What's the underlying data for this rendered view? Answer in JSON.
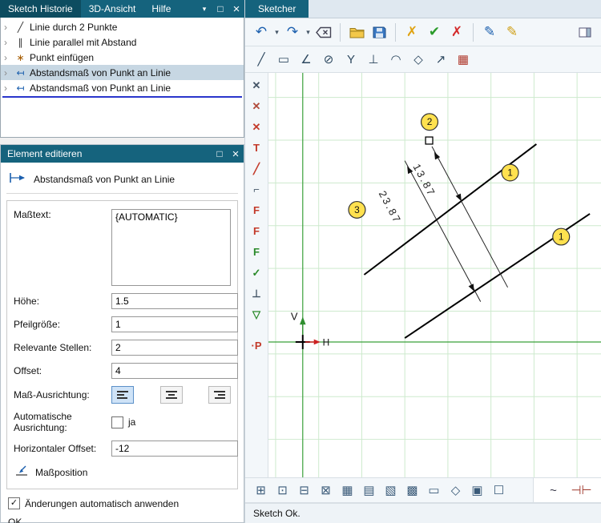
{
  "history_panel": {
    "chevron_glyph": "›",
    "tabs": [
      {
        "label": "Sketch Historie"
      },
      {
        "label": "3D-Ansicht"
      },
      {
        "label": "Hilfe"
      }
    ],
    "window_controls": {
      "menu_glyph": "▾",
      "maximize_glyph": "□",
      "close_glyph": "×"
    },
    "items": [
      {
        "label": "Linie durch 2 Punkte",
        "icon": "line-icon",
        "glyph": "╱",
        "color": "#333333",
        "selected": false
      },
      {
        "label": "Linie parallel mit Abstand",
        "icon": "parallel-lines-icon",
        "glyph": "∥",
        "color": "#333333",
        "selected": false
      },
      {
        "label": "Punkt einfügen",
        "icon": "point-icon",
        "glyph": "∗",
        "color": "#a65c00",
        "selected": false
      },
      {
        "label": "Abstandsmaß von Punkt an Linie",
        "icon": "dimension-icon",
        "glyph": "↤",
        "color": "#1b5fae",
        "selected": true
      },
      {
        "label": "Abstandsmaß von Punkt an Linie",
        "icon": "dimension-icon",
        "glyph": "↤",
        "color": "#1b5fae",
        "selected": false
      }
    ]
  },
  "edit_panel": {
    "title": "Element editieren",
    "window_controls": {
      "maximize_glyph": "□",
      "close_glyph": "×"
    },
    "header": "Abstandsmaß von Punkt an Linie",
    "fields": {
      "masstext": {
        "label": "Maßtext:",
        "value": "{AUTOMATIC}"
      },
      "hoehe": {
        "label": "Höhe:",
        "value": "1.5"
      },
      "pfeilgroesse": {
        "label": "Pfeilgröße:",
        "value": "1"
      },
      "relevante_stellen": {
        "label": "Relevante Stellen:",
        "value": "2"
      },
      "offset": {
        "label": "Offset:",
        "value": "4"
      },
      "mass_ausrichtung": {
        "label": "Maß-Ausrichtung:"
      },
      "automatische_ausrichtung": {
        "label": "Automatische Ausrichtung:",
        "option": "ja",
        "checked": false
      },
      "horizontaler_offset": {
        "label": "Horizontaler Offset:",
        "value": "-12"
      },
      "massposition": {
        "label": "Maßposition"
      }
    },
    "apply_checkbox": {
      "label": "Änderungen automatisch anwenden",
      "checked": true
    },
    "ok_label": "OK"
  },
  "sketcher": {
    "tab_label": "Sketcher",
    "status": "Sketch Ok.",
    "caret_glyph": "▾",
    "toolbar_main": [
      {
        "name": "undo-button",
        "glyph": "↶",
        "color": "#1b5fae",
        "caret": true
      },
      {
        "name": "redo-button",
        "glyph": "↷",
        "color": "#1b5fae",
        "caret": true
      },
      {
        "name": "backspace-button",
        "svg": "backspace"
      },
      {
        "sep": true
      },
      {
        "name": "open-file-button",
        "svg": "folder"
      },
      {
        "name": "save-button",
        "svg": "floppy"
      },
      {
        "sep": true
      },
      {
        "name": "delete-element-button",
        "glyph": "✗",
        "color": "#e0a312"
      },
      {
        "name": "confirm-button",
        "glyph": "✔",
        "color": "#2a9b2a"
      },
      {
        "name": "cancel-button",
        "glyph": "✗",
        "color": "#d42a2a"
      },
      {
        "sep": true
      },
      {
        "name": "edit-pencil-button",
        "glyph": "✎",
        "color": "#1b5fae"
      },
      {
        "name": "edit-pencil-alt-button",
        "glyph": "✎",
        "color": "#cf9f16"
      },
      {
        "spacer": true
      },
      {
        "name": "panel-toggle-button",
        "svg": "panel"
      }
    ],
    "toolbar_draw": [
      {
        "name": "polyline-tool-button",
        "glyph": "╱",
        "color": "#2e4960"
      },
      {
        "name": "rectangle-tool-button",
        "glyph": "▭",
        "color": "#2e4960"
      },
      {
        "name": "angle-tool-button",
        "glyph": "∠",
        "color": "#2e4960"
      },
      {
        "name": "circle-tool-button",
        "glyph": "⊘",
        "color": "#2e4960"
      },
      {
        "name": "branch-tool-button",
        "glyph": "Y",
        "color": "#2e4960"
      },
      {
        "name": "perpendicular-tool-button",
        "glyph": "⊥",
        "color": "#2e4960"
      },
      {
        "name": "arc-tool-button",
        "glyph": "◠",
        "color": "#2e4960"
      },
      {
        "name": "chamfer-tool-button",
        "glyph": "◇",
        "color": "#2e4960"
      },
      {
        "name": "point-line-tool-button",
        "glyph": "↗",
        "color": "#2e4960"
      },
      {
        "name": "grid-tool-button",
        "glyph": "▦",
        "color": "#b03a2e"
      }
    ],
    "toolbar_constraints": [
      {
        "name": "snap-x1-button",
        "glyph": "✕",
        "color": "#445566"
      },
      {
        "name": "snap-x2-button",
        "glyph": "✕",
        "color": "#b04a3a"
      },
      {
        "name": "snap-x3-button",
        "glyph": "✕",
        "color": "#c33a2a"
      },
      {
        "name": "tangent-constraint-button",
        "glyph": "T",
        "color": "#c33a2a"
      },
      {
        "name": "angle-constraint-button",
        "glyph": "╱",
        "color": "#c33a2a"
      },
      {
        "name": "corner-constraint-button",
        "glyph": "⌐",
        "color": "#445566"
      },
      {
        "name": "fix-point-constraint-button",
        "glyph": "F",
        "color": "#c33a2a"
      },
      {
        "name": "fix-angle-constraint-button",
        "glyph": "F",
        "color": "#c33a2a"
      },
      {
        "name": "fix-length-constraint-button",
        "glyph": "F",
        "color": "#2a8a2a"
      },
      {
        "name": "check-constraint-button",
        "glyph": "✓",
        "color": "#2a8a2a"
      },
      {
        "name": "perpendicular-constraint-button",
        "glyph": "⊥",
        "color": "#445566"
      },
      {
        "name": "triangle-constraint-button",
        "glyph": "▽",
        "color": "#2a8a2a"
      },
      {
        "gap": true
      },
      {
        "name": "point-display-button",
        "glyph": "·P",
        "color": "#c33a2a"
      }
    ],
    "toolbar_bottom": [
      {
        "name": "zoom-fit-button",
        "glyph": "⊞",
        "color": "#3a5a78"
      },
      {
        "name": "zoom-window-button",
        "glyph": "⊡",
        "color": "#3a5a78"
      },
      {
        "name": "zoom-minus-button",
        "glyph": "⊟",
        "color": "#3a5a78"
      },
      {
        "name": "zoom-select-button",
        "glyph": "⊠",
        "color": "#3a5a78"
      },
      {
        "name": "view-grid-button",
        "glyph": "▦",
        "color": "#3a5a78"
      },
      {
        "name": "view-rows-button",
        "glyph": "▤",
        "color": "#3a5a78"
      },
      {
        "name": "view-hatch-button",
        "glyph": "▧",
        "color": "#3a5a78"
      },
      {
        "name": "view-dense-button",
        "glyph": "▩",
        "color": "#3a5a78"
      },
      {
        "name": "view-rect-button",
        "glyph": "▭",
        "color": "#3a5a78"
      },
      {
        "name": "view-diamond-button",
        "glyph": "◇",
        "color": "#3a5a78"
      },
      {
        "name": "view-square-button",
        "glyph": "▣",
        "color": "#3a5a78"
      },
      {
        "name": "view-empty-button",
        "glyph": "☐",
        "color": "#3a5a78"
      }
    ],
    "toolbar_bottom_right": [
      {
        "name": "smooth-toggle-button",
        "glyph": "~",
        "color": "#333344"
      },
      {
        "name": "endpoints-toggle-button",
        "glyph": "⊣⊢",
        "color": "#a03a2e"
      }
    ]
  },
  "drawing": {
    "v_label": "V",
    "h_label": "H",
    "dimensions": {
      "dim1": "13.87",
      "dim2": "23.87"
    },
    "balloons": {
      "line1_a": "1",
      "line1_b": "1",
      "point": "2",
      "dimension": "3"
    }
  }
}
